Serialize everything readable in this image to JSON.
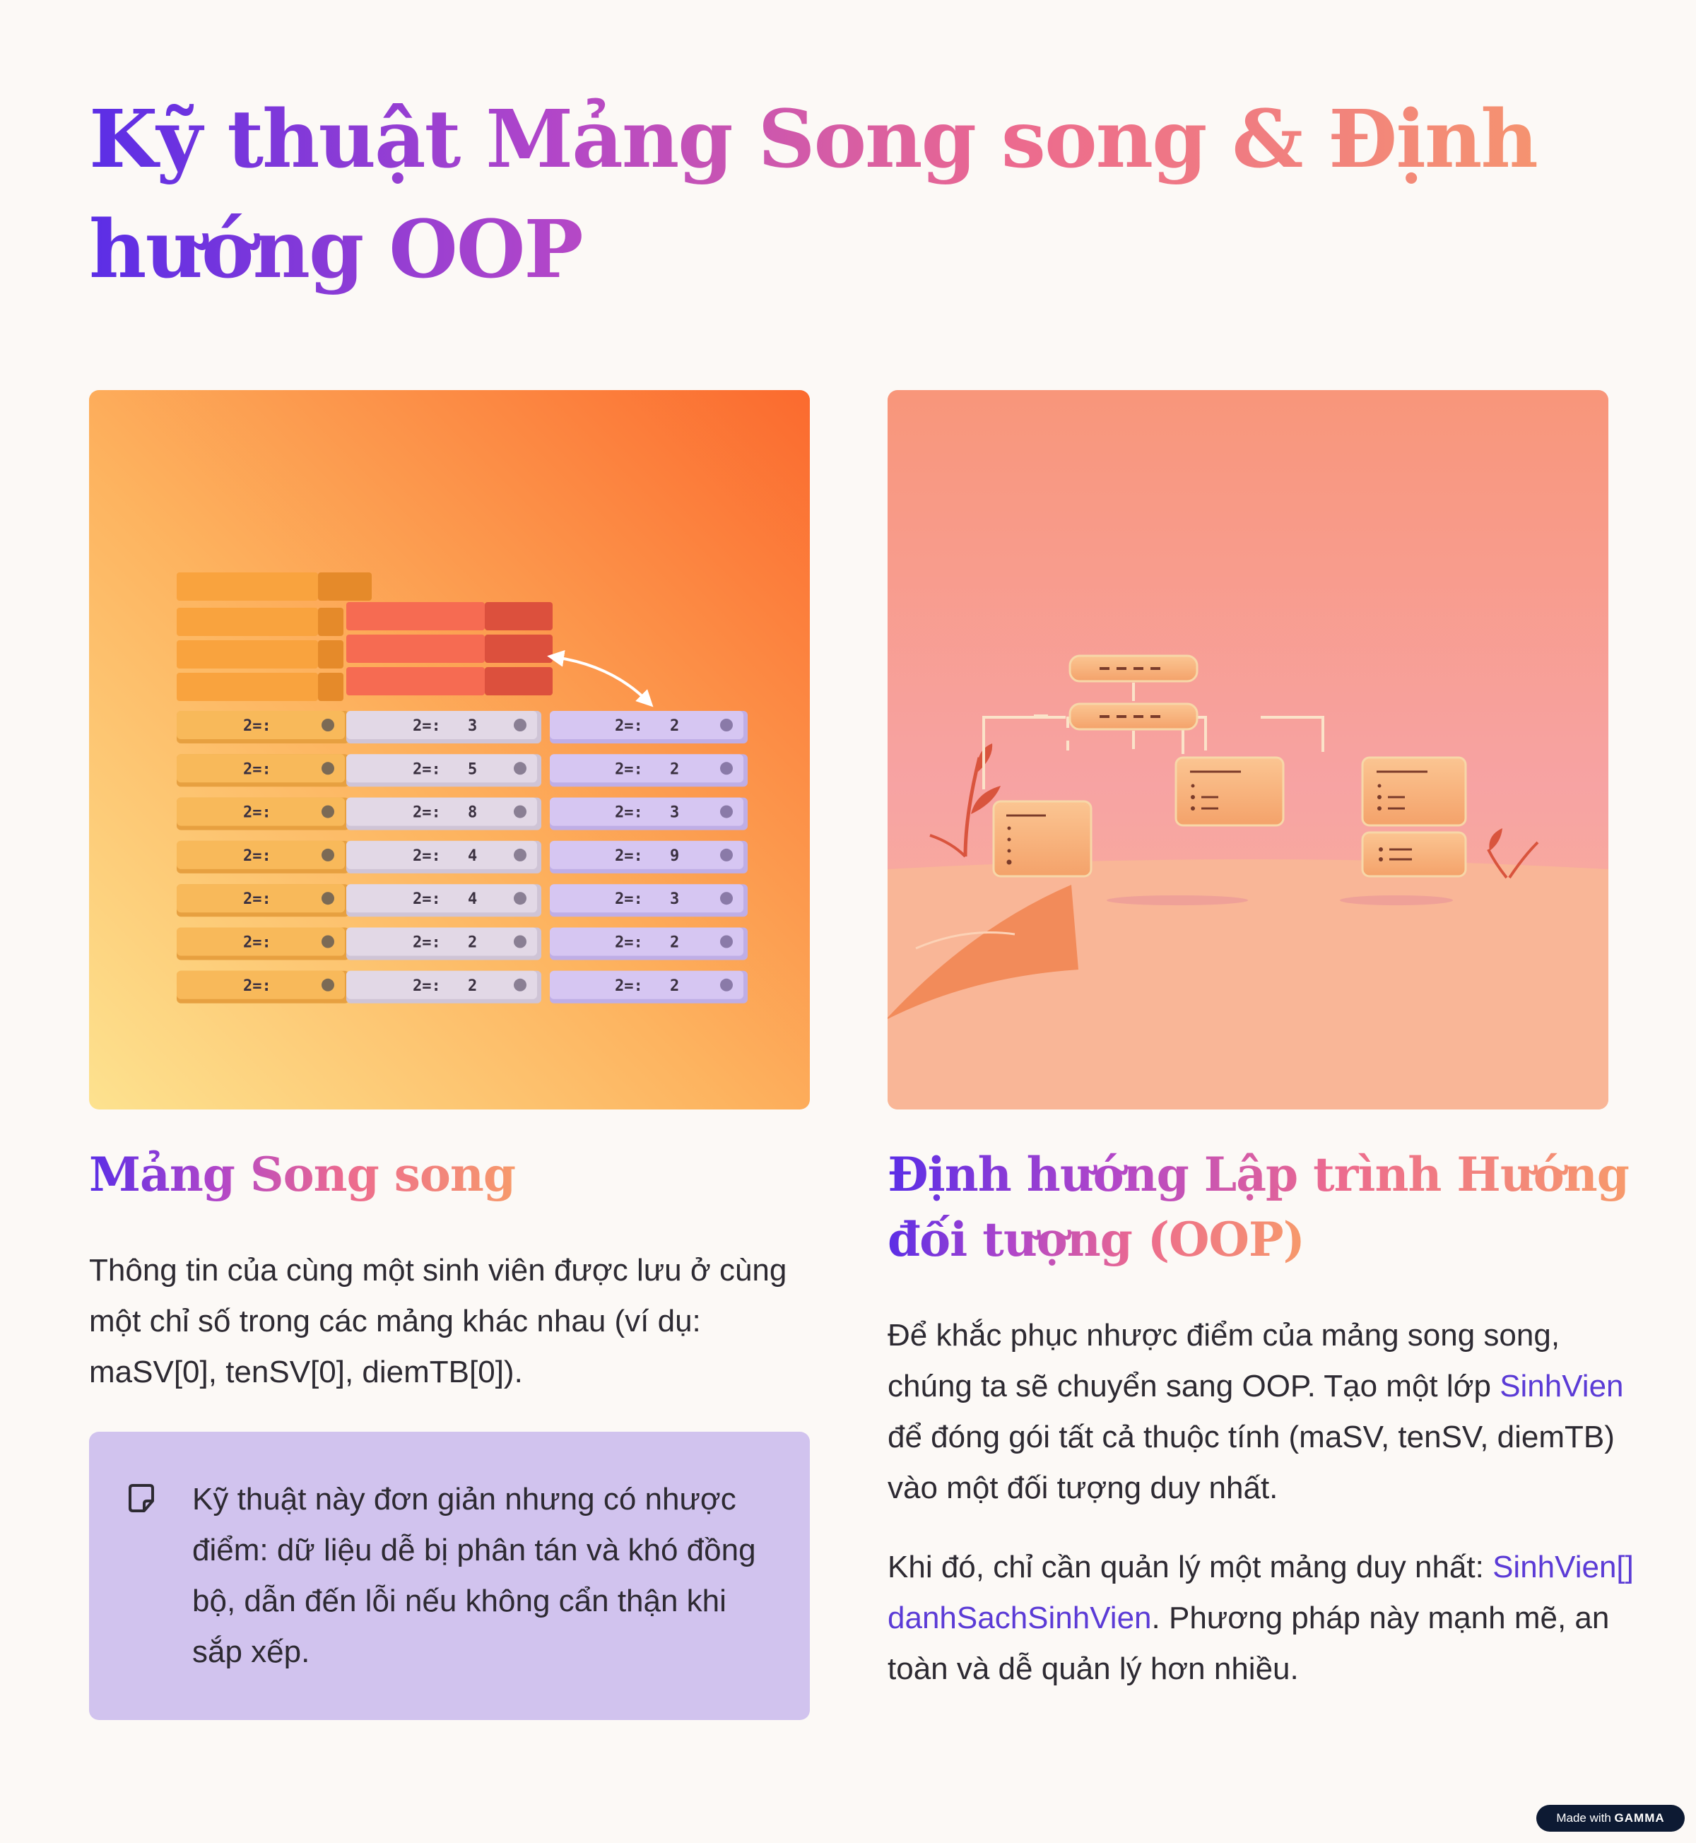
{
  "title": {
    "line": "Kỹ thuật Mảng Song song & Định hướng OOP"
  },
  "left": {
    "heading": "Mảng Song song",
    "body": "Thông tin của cùng một sinh viên được lưu ở cùng một chỉ số trong các mảng khác nhau (ví dụ: maSV[0], tenSV[0], diemTB[0]).",
    "note": {
      "icon": "note-icon",
      "text": "Kỹ thuật này đơn giản nhưng có nhược điểm: dữ liệu dễ bị phân tán và khó đồng bộ, dẫn đến lỗi nếu không cẩn thận khi sắp xếp."
    },
    "illustration": {
      "cell_label": "2=:",
      "column_a_values": [
        "",
        "",
        "",
        "",
        "",
        "",
        ""
      ],
      "column_b_values": [
        "3",
        "5",
        "8",
        "4",
        "4",
        "2",
        "2"
      ],
      "column_c_values": [
        "2",
        "2",
        "3",
        "9",
        "3",
        "2",
        "2"
      ]
    }
  },
  "right": {
    "heading_line1": "Định hướng Lập trình Hướng",
    "heading_line2": "đối tượng (OOP)",
    "p1_before": "Để khắc phục nhược điểm của mảng song song, chúng ta sẽ chuyển sang OOP. Tạo một lớp ",
    "p1_code": "SinhVien",
    "p1_after": " để đóng gói tất cả thuộc tính (maSV, tenSV, diemTB) vào một đối tượng duy nhất.",
    "p2_before": "Khi đó, chỉ cần quản lý một mảng duy nhất: ",
    "p2_code": "SinhVien[] danhSachSinhVien",
    "p2_after": ". Phương pháp này mạnh mẽ, an toàn và dễ quản lý hơn nhiều."
  },
  "badge": {
    "prefix": "Made with",
    "brand": "GAMMA"
  },
  "colors": {
    "accent_purple": "#5b3bd6",
    "note_bg": "#d1c3ee",
    "page_bg": "#fcf9f6"
  }
}
